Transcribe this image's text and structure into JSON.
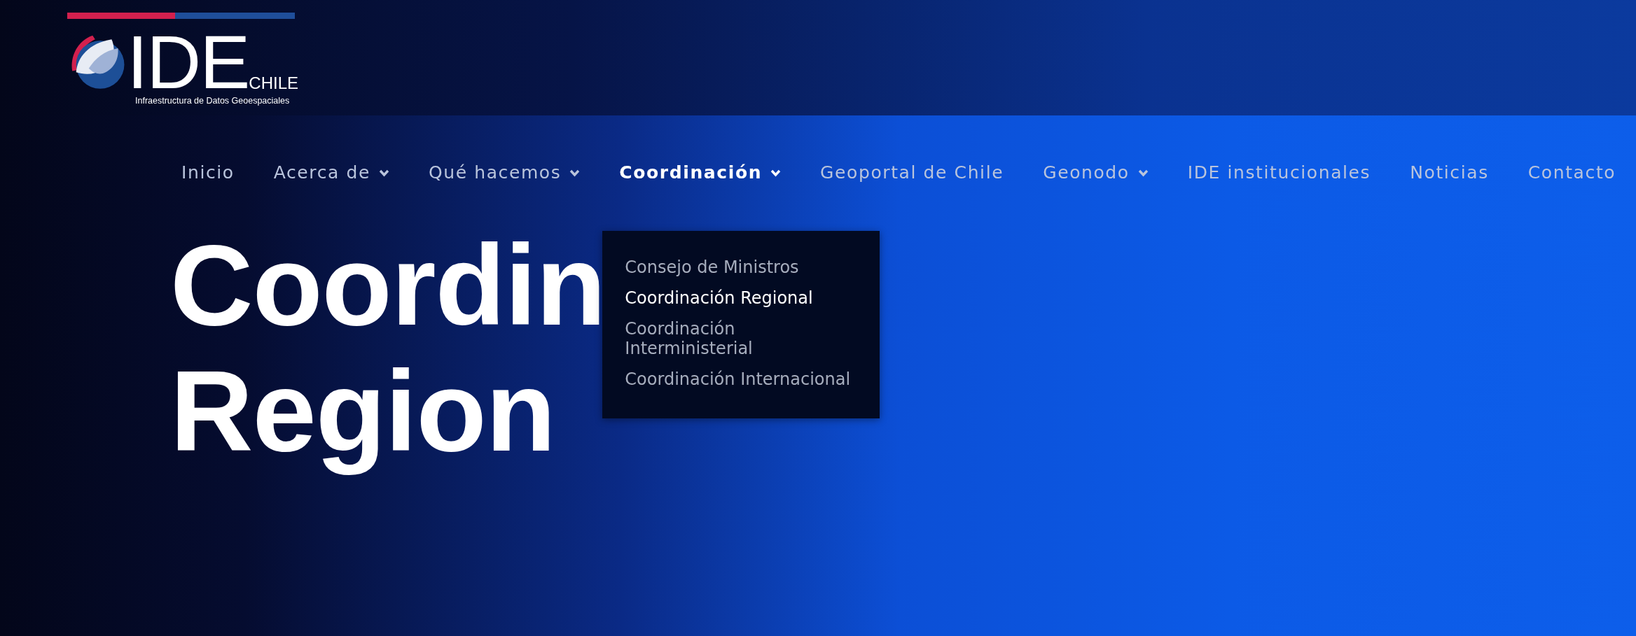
{
  "logo": {
    "name": "IDE",
    "suffix": "CHILE",
    "tagline": "Infraestructura de Datos Geoespaciales"
  },
  "nav": [
    {
      "label": "Inicio",
      "has_dropdown": false,
      "selected": false
    },
    {
      "label": "Acerca de",
      "has_dropdown": true,
      "selected": false
    },
    {
      "label": "Qué hacemos",
      "has_dropdown": true,
      "selected": false
    },
    {
      "label": "Coordinación",
      "has_dropdown": true,
      "selected": true,
      "expanded": true
    },
    {
      "label": "Geoportal de Chile",
      "has_dropdown": false,
      "selected": false
    },
    {
      "label": "Geonodo",
      "has_dropdown": true,
      "selected": false
    },
    {
      "label": "IDE institucionales",
      "has_dropdown": false,
      "selected": false
    },
    {
      "label": "Noticias",
      "has_dropdown": false,
      "selected": false
    },
    {
      "label": "Contacto",
      "has_dropdown": false,
      "selected": false
    }
  ],
  "dropdown": [
    {
      "label": "Consejo de Ministros",
      "selected": false
    },
    {
      "label": "Coordinación Regional",
      "selected": true
    },
    {
      "label": "Coordinación Interministerial",
      "selected": false
    },
    {
      "label": "Coordinación Internacional",
      "selected": false
    }
  ],
  "hero": {
    "title_lines": [
      {
        "parts": [
          "Coordin"
        ]
      },
      {
        "parts": [
          "Region"
        ]
      }
    ]
  }
}
